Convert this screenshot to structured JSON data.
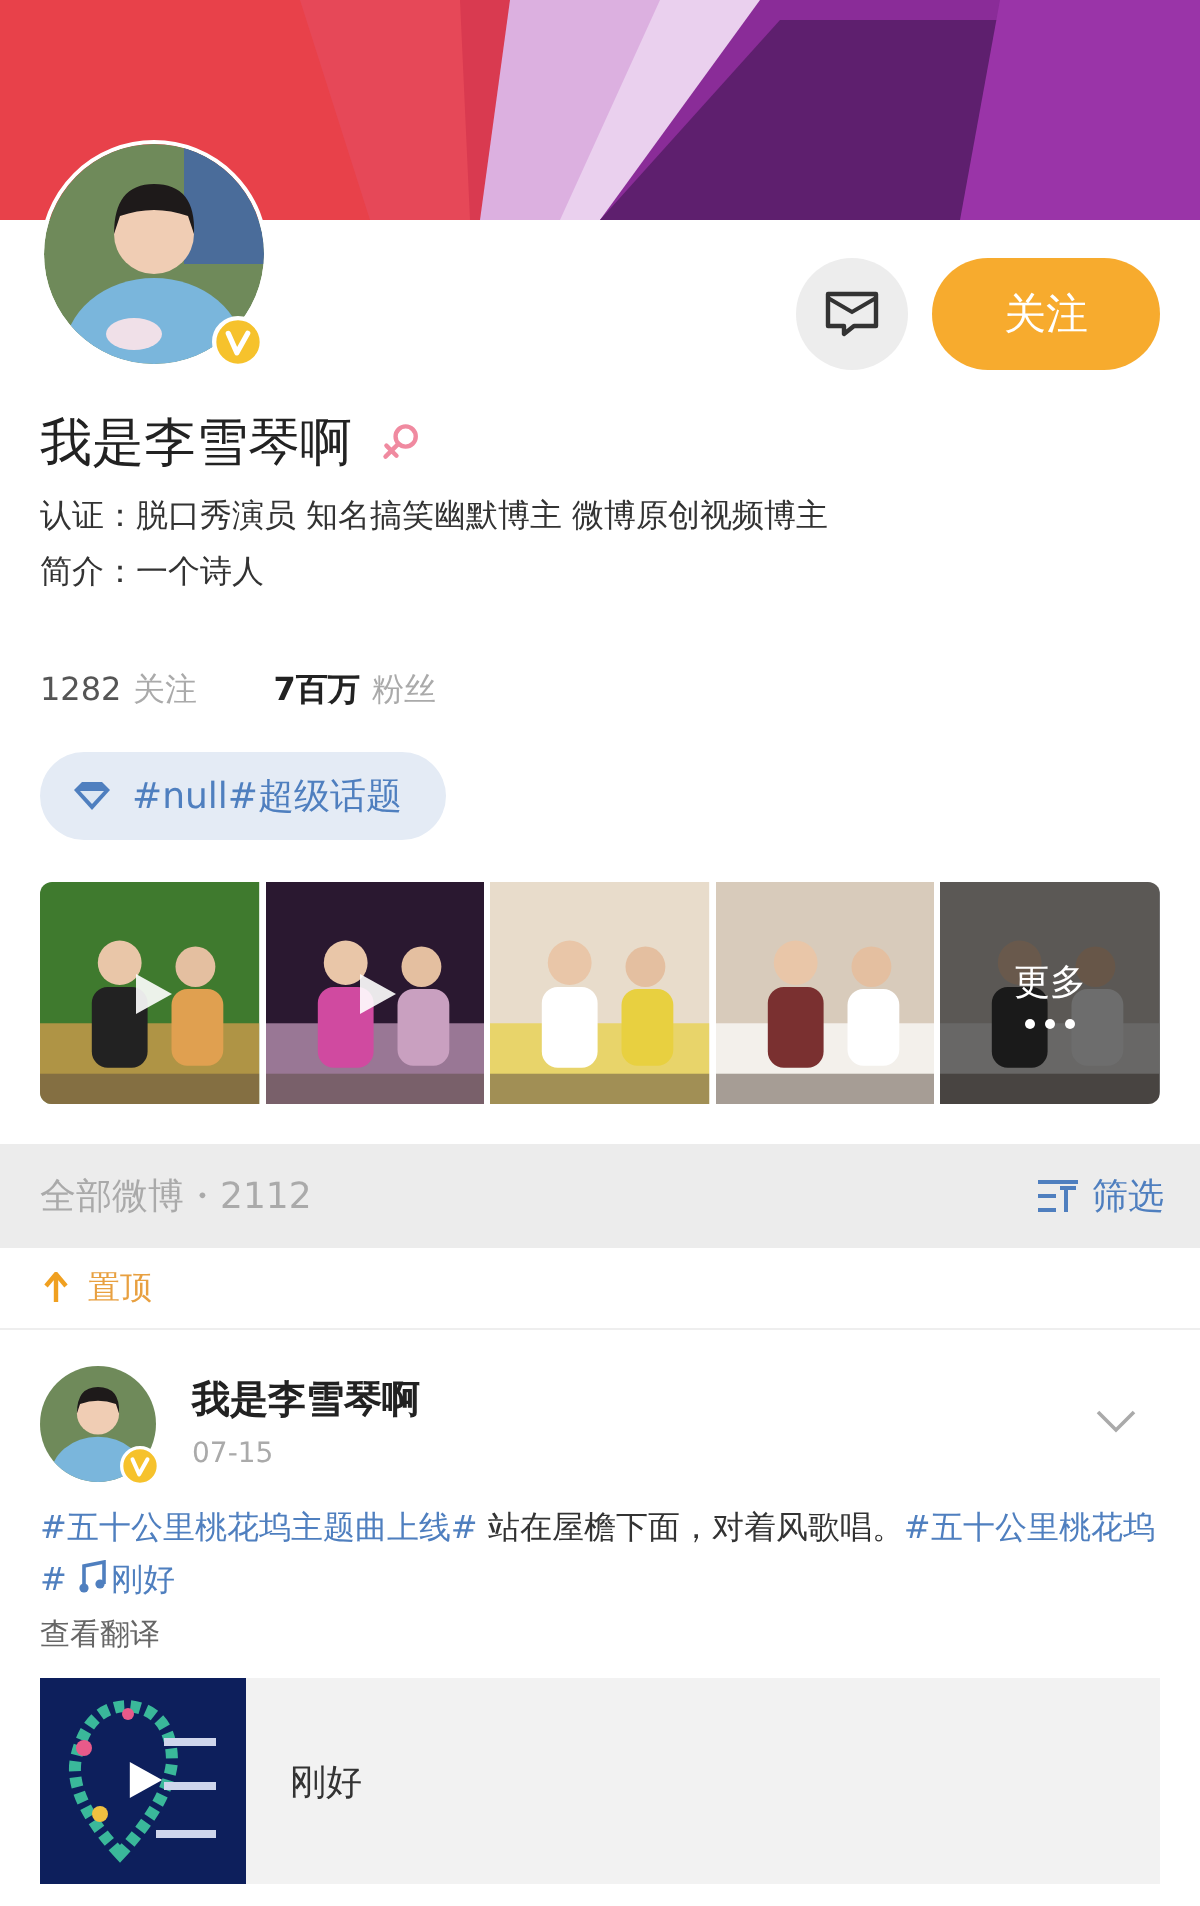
{
  "profile": {
    "name": "我是李雪琴啊",
    "verification": "认证：脱口秀演员 知名搞笑幽默博主 微博原创视频博主",
    "intro": "简介：一个诗人",
    "follow_button": "关注"
  },
  "stats": [
    {
      "value": "1282",
      "label": "关注"
    },
    {
      "value": "7百万",
      "label": "粉丝"
    }
  ],
  "super_topic": "#null#超级话题",
  "videos": [
    {
      "kind": "video"
    },
    {
      "kind": "video"
    },
    {
      "kind": "plain"
    },
    {
      "kind": "plain"
    },
    {
      "kind": "more",
      "label": "更多"
    }
  ],
  "feed_header": {
    "title": "全部微博・2112",
    "filter": "筛选"
  },
  "pinned": "置顶",
  "post": {
    "author": "我是李雪琴啊",
    "date": "07-15",
    "segments": [
      {
        "kind": "topic",
        "text": "#五十公里桃花坞主题曲上线#"
      },
      {
        "kind": "text",
        "text": " 站在屋檐下面，对着风歌唱。"
      },
      {
        "kind": "topic",
        "text": "#五十公里桃花坞#"
      },
      {
        "kind": "music",
        "text": "刚好"
      }
    ],
    "translate": "查看翻译",
    "music_card": {
      "title": "刚好"
    }
  }
}
